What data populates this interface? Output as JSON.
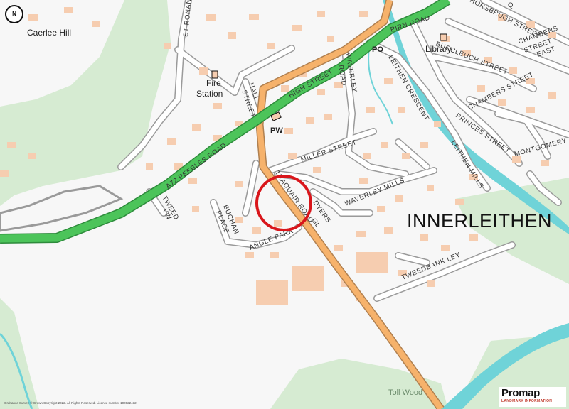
{
  "compass": {
    "label": "N"
  },
  "labels": {
    "town": "INNERLEITHEN",
    "caerlee_hill": "Caerlee Hill",
    "fire_station_line1": "Fire",
    "fire_station_line2": "Station",
    "pw": "PW",
    "po": "PO",
    "library": "Library",
    "toll_wood": "Toll Wood"
  },
  "streets": {
    "st_ronan": "ST RONAN",
    "pirn_road": "PIRN ROAD",
    "high_street": "HIGH STREET",
    "hall_street_1": "HALL",
    "hall_street_2": "STREET",
    "waverley_road_1": "WAVERLEY",
    "waverley_road_2": "ROAD",
    "leithen_crescent": "LEITHEN CRESCENT",
    "buccleuch_street": "BUCCLEUCH STREET",
    "horsbrugh_street": "HORSBRUGH STREET",
    "chambers_street": "CHAMBERS STREET",
    "chambers_street_east_1": "CHAMBERS",
    "chambers_street_east_2": "STREET",
    "chambers_street_east_3": "EAST",
    "princes_street": "PRINCES STREET",
    "montgomery_street": "MONTGOMERY S",
    "a72_peebles_road": "A72  PEEBLES ROAD",
    "miller_street": "MILLER STREET",
    "traquair_road": "TRAQUAIR ROAD",
    "dyers": "DYERS",
    "waverley_mills": "WAVERLEY MILLS",
    "leithen_mills": "LEITHEN MILLS",
    "tweed_vw_1": "TWEED",
    "tweed_vw_2": "VW",
    "buchan_place_1": "BUCHAN",
    "buchan_place_2": "PLACE",
    "angle_park": "ANGLE PARK",
    "tweedbank_ley": "TWEEDBANK LEY",
    "gl": "GL",
    "top_street": "Q"
  },
  "footer": {
    "copyright": "Ordnance Survey © Crown Copyright 2022. All Rights Reserved. Licence number 100022432",
    "brand": "Promap",
    "brand_sub": "LANDMARK INFORMATION"
  },
  "colors": {
    "a_road": "#4cc45a",
    "b_road": "#f6b26b",
    "building": "#f6cdb0",
    "water": "#6fd3d8",
    "green": "#d6ebd2",
    "marker": "#d9161b"
  },
  "marker": {
    "type": "circle",
    "label": "site location"
  }
}
